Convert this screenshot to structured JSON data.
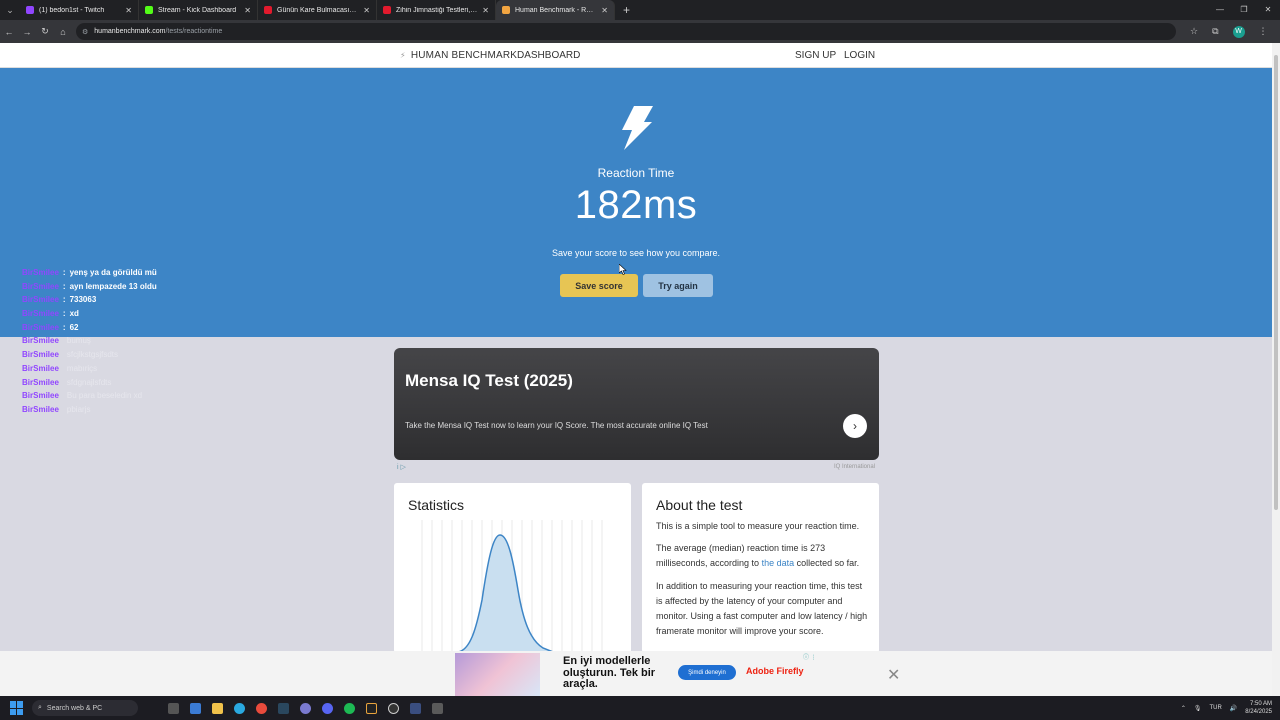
{
  "browser": {
    "tabs": [
      {
        "title": "(1) bedon1st - Twitch",
        "color": "#9146ff"
      },
      {
        "title": "Stream - Kick Dashboard",
        "color": "#53fc18"
      },
      {
        "title": "Günün Kare Bulmacası | HT Bulm",
        "color": "#e21a2d"
      },
      {
        "title": "Zihin Jimnastiği Testleri, Akıl &",
        "color": "#e21a2d"
      },
      {
        "title": "Human Benchmark - Reaction Ti",
        "color": "#f2a541"
      }
    ],
    "url_host": "humanbenchmark.com",
    "url_path": "/tests/reactiontime",
    "profile_initial": "W"
  },
  "site": {
    "brand": "HUMAN BENCHMARK",
    "dashboard": "DASHBOARD",
    "signup": "SIGN UP",
    "login": "LOGIN"
  },
  "hero": {
    "label": "Reaction Time",
    "score": "182ms",
    "message": "Save your score to see how you compare.",
    "save_label": "Save score",
    "try_label": "Try again"
  },
  "chat": [
    {
      "user": "BirSmilee",
      "msg": "yenş ya da görüldü mü"
    },
    {
      "user": "BirSmilee",
      "msg": "ayn lempazede 13 oldu"
    },
    {
      "user": "BirSmilee",
      "msg": "733063"
    },
    {
      "user": "BirSmilee",
      "msg": "xd"
    },
    {
      "user": "BirSmilee",
      "msg": "62"
    },
    {
      "user": "BirSmilee",
      "msg": "bumuş"
    },
    {
      "user": "BirSmilee",
      "msg": "sfcjlkstgsjfsdts"
    },
    {
      "user": "BirSmilee",
      "msg": "mabıriçs"
    },
    {
      "user": "BirSmilee",
      "msg": "sfdgnajlsfdts"
    },
    {
      "user": "BirSmilee",
      "msg": "Bu para beseledin xd"
    },
    {
      "user": "BirSmilee",
      "msg": "pbiarjs"
    }
  ],
  "ad": {
    "title": "Mensa IQ Test (2025)",
    "desc": "Take the Mensa IQ Test now to learn your IQ Score. The most accurate online IQ Test",
    "source": "IQ International"
  },
  "stats": {
    "title": "Statistics"
  },
  "about": {
    "title": "About the test",
    "p1": "This is a simple tool to measure your reaction time.",
    "p2_pre": "The average (median) reaction time is 273 milliseconds, according to ",
    "p2_link": "the data",
    "p2_post": " collected so far.",
    "p3": "In addition to measuring your reaction time, this test is affected by the latency of your computer and monitor. Using a fast computer and low latency / high framerate monitor will improve your score."
  },
  "bottom_ad": {
    "headline": "En iyi modellerle oluşturun. Tek bir araçla.",
    "cta": "Şimdi deneyin",
    "brand": "Adobe Firefly"
  },
  "taskbar": {
    "search": "Search web & PC",
    "lang": "TUR",
    "time": "7:50 AM",
    "date": "8/24/2025"
  }
}
